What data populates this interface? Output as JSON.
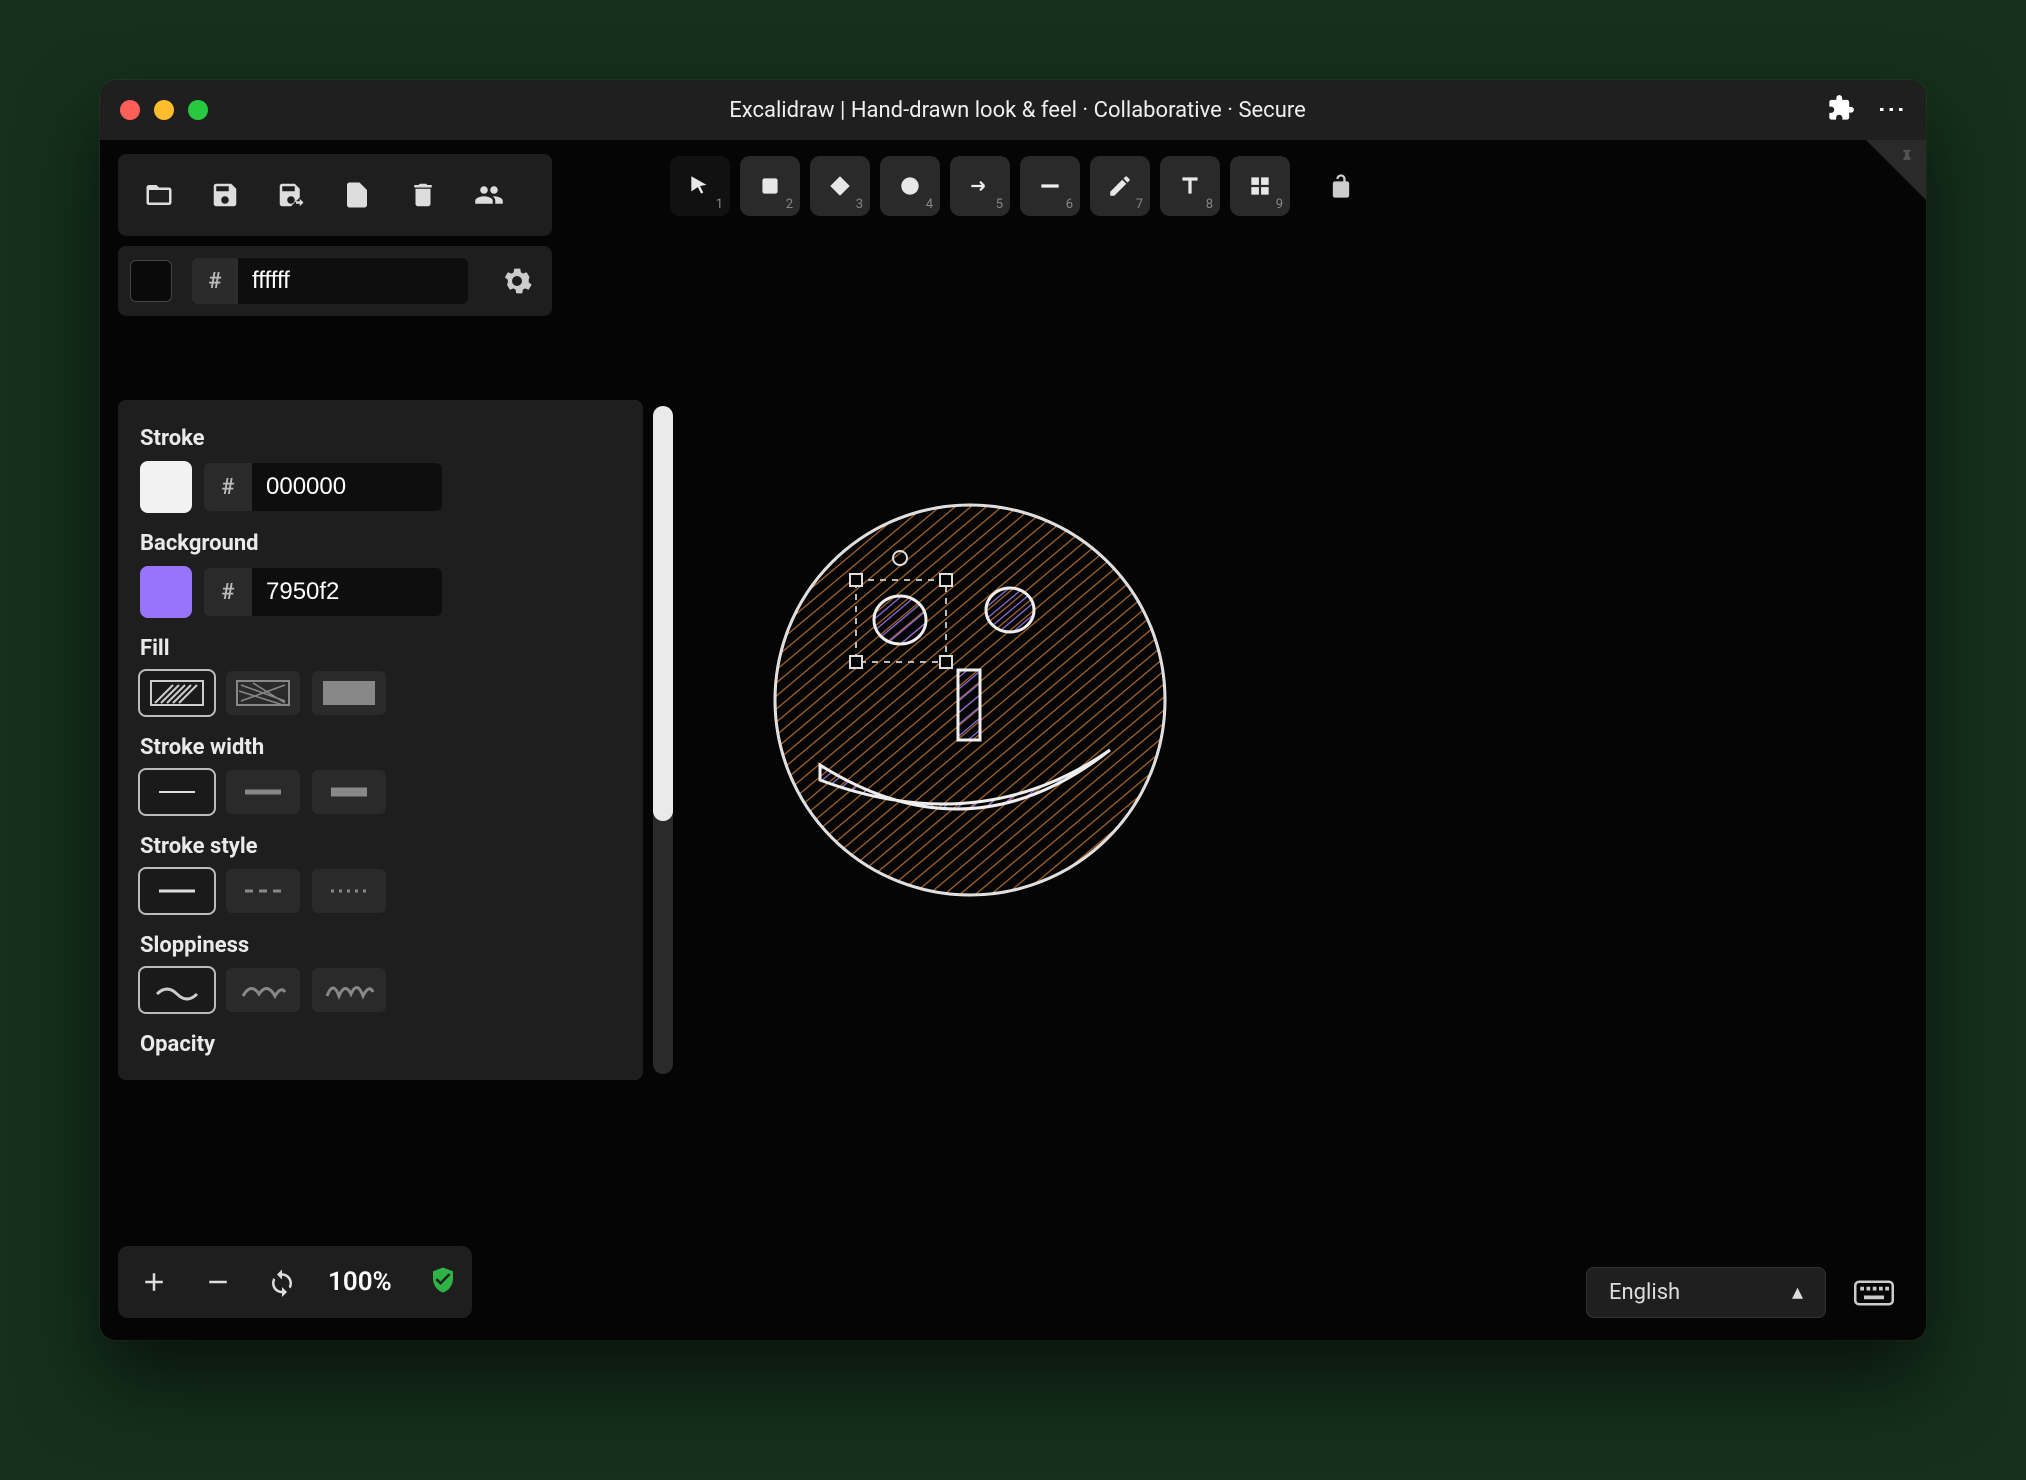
{
  "window": {
    "title": "Excalidraw | Hand-drawn look & feel · Collaborative · Secure"
  },
  "canvas_color": {
    "hash": "#",
    "value": "ffffff"
  },
  "tools": [
    {
      "name": "selection",
      "sub": "1"
    },
    {
      "name": "rectangle",
      "sub": "2"
    },
    {
      "name": "diamond",
      "sub": "3"
    },
    {
      "name": "ellipse",
      "sub": "4"
    },
    {
      "name": "arrow",
      "sub": "5"
    },
    {
      "name": "line",
      "sub": "6"
    },
    {
      "name": "draw",
      "sub": "7"
    },
    {
      "name": "text",
      "sub": "8"
    },
    {
      "name": "grid",
      "sub": "9"
    }
  ],
  "props": {
    "stroke_label": "Stroke",
    "stroke_hash": "#",
    "stroke_value": "000000",
    "stroke_swatch": "#f2f2f2",
    "bg_label": "Background",
    "bg_hash": "#",
    "bg_value": "7950f2",
    "bg_swatch": "#9775fa",
    "fill_label": "Fill",
    "stroke_width_label": "Stroke width",
    "stroke_style_label": "Stroke style",
    "sloppiness_label": "Sloppiness",
    "opacity_label": "Opacity"
  },
  "zoom": {
    "value": "100%"
  },
  "lang": {
    "value": "English"
  }
}
